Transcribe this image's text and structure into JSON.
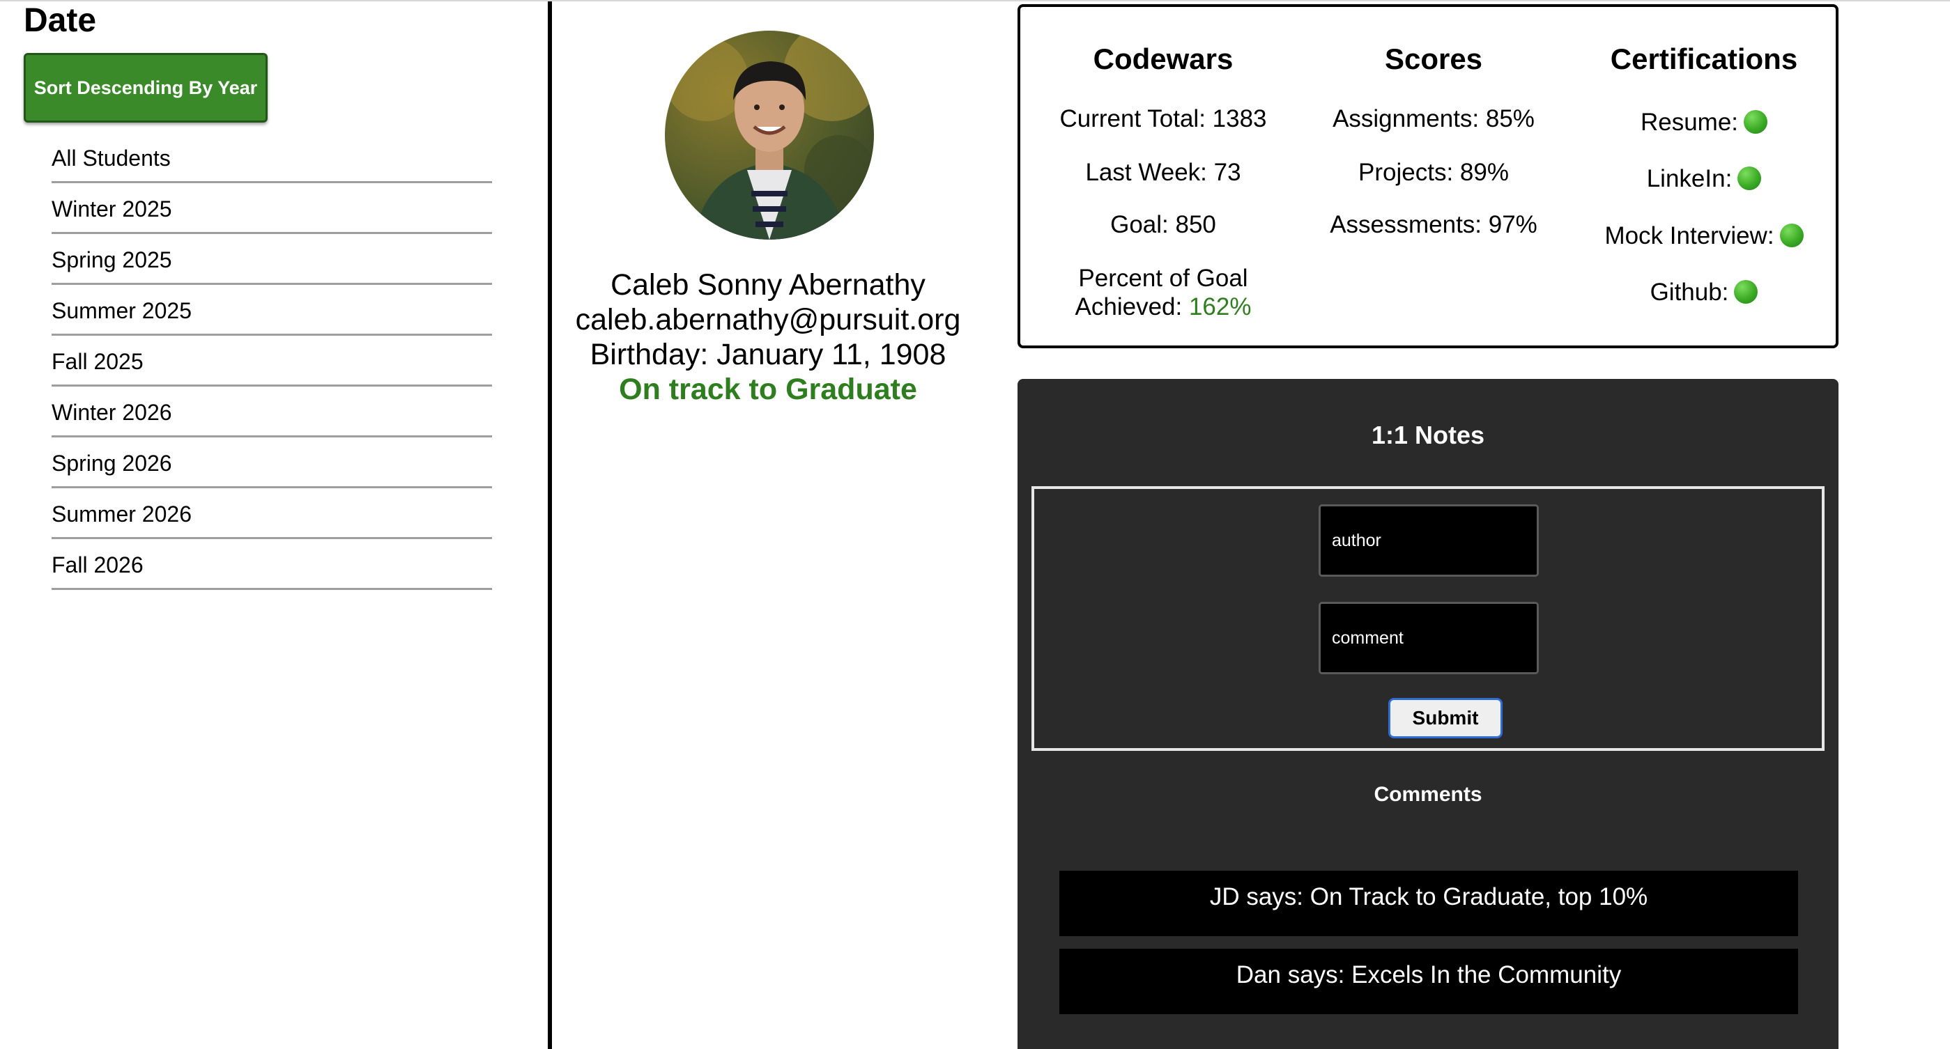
{
  "sidebar": {
    "title": "Date",
    "sort_button": "Sort Descending By Year",
    "items": [
      {
        "label": "All Students"
      },
      {
        "label": "Winter 2025"
      },
      {
        "label": "Spring 2025"
      },
      {
        "label": "Summer 2025"
      },
      {
        "label": "Fall 2025"
      },
      {
        "label": "Winter 2026"
      },
      {
        "label": "Spring 2026"
      },
      {
        "label": "Summer 2026"
      },
      {
        "label": "Fall 2026"
      }
    ]
  },
  "profile": {
    "name": "Caleb Sonny Abernathy",
    "email": "caleb.abernathy@pursuit.org",
    "birthday": "Birthday: January 11, 1908",
    "status": "On track to Graduate",
    "status_color": "#2e7d1e"
  },
  "stats": {
    "codewars": {
      "title": "Codewars",
      "current_total": "Current Total: 1383",
      "last_week": "Last Week: 73",
      "goal": "Goal: 850",
      "percent_label_line1": "Percent of Goal",
      "percent_label_line2": "Achieved: ",
      "percent_value": "162%"
    },
    "scores": {
      "title": "Scores",
      "assignments": "Assignments: 85%",
      "projects": "Projects: 89%",
      "assessments": "Assessments: 97%"
    },
    "certifications": {
      "title": "Certifications",
      "items": [
        {
          "label": "Resume:",
          "status_icon": "green-dot-icon"
        },
        {
          "label": "LinkeIn:",
          "status_icon": "green-dot-icon"
        },
        {
          "label": "Mock Interview:",
          "status_icon": "green-dot-icon"
        },
        {
          "label": "Github:",
          "status_icon": "green-dot-icon"
        }
      ]
    }
  },
  "notes": {
    "title": "1:1 Notes",
    "author_placeholder": "author",
    "comment_placeholder": "comment",
    "submit_label": "Submit",
    "comments_title": "Comments",
    "comments": [
      {
        "text": "JD says: On Track to Graduate, top 10%"
      },
      {
        "text": "Dan says: Excels In the Community"
      }
    ]
  },
  "colors": {
    "accent_green": "#3a8a2a",
    "panel_dark": "#2a2a2a",
    "status_green": "#3bab25"
  }
}
